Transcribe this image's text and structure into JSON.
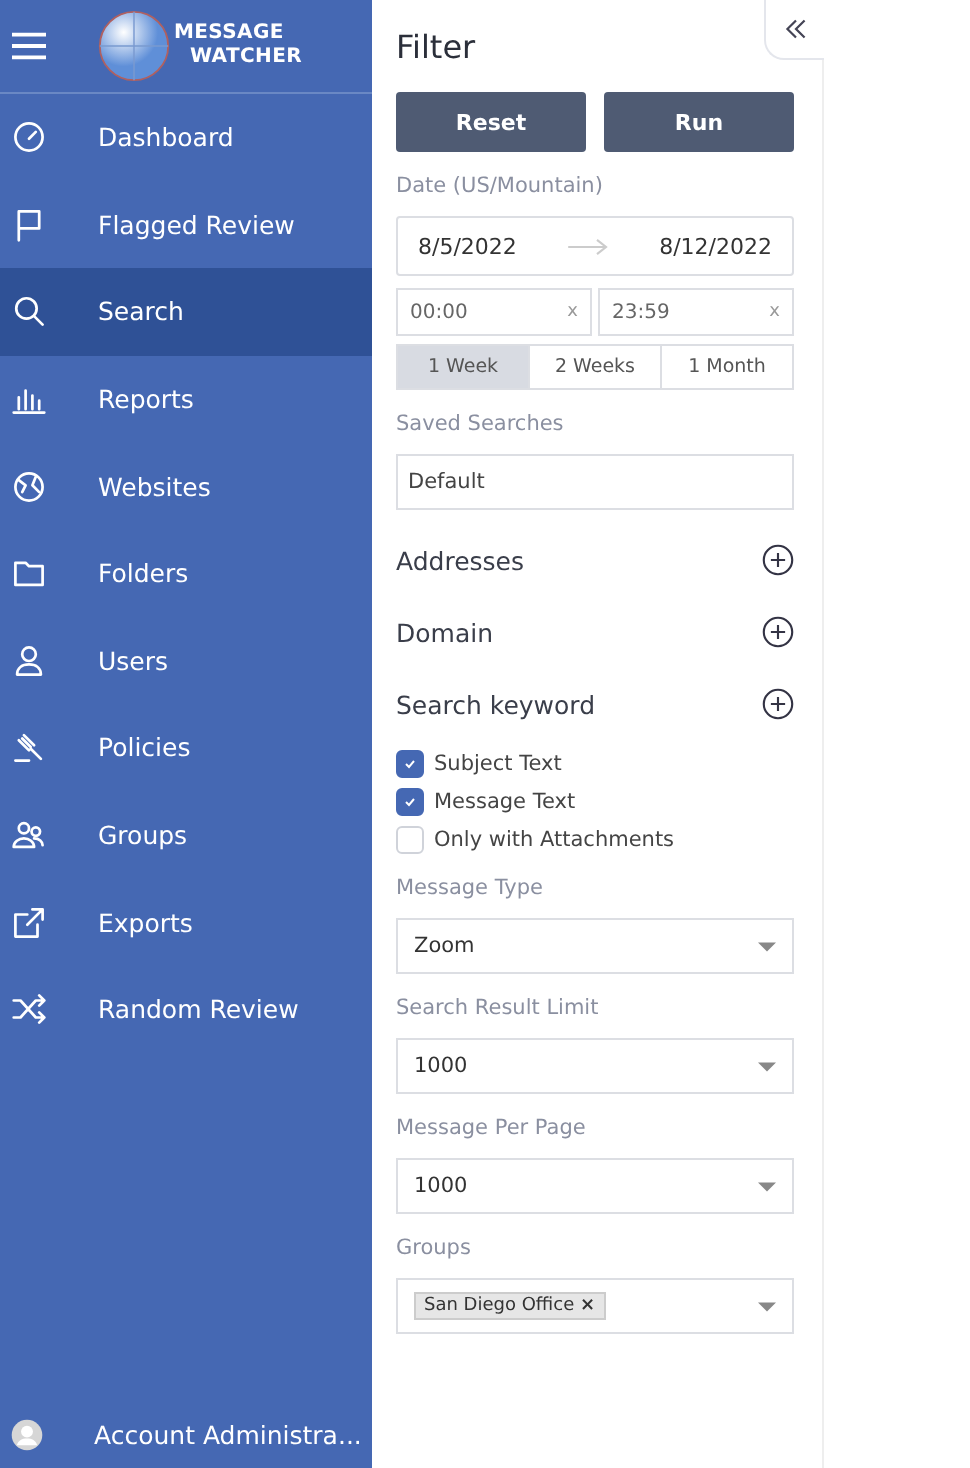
{
  "sidebar": {
    "logo_lines": [
      "MESSAGE",
      "WATCHER"
    ],
    "items": [
      {
        "label": "Dashboard",
        "selected": false
      },
      {
        "label": "Flagged Review",
        "selected": false
      },
      {
        "label": "Search",
        "selected": true
      },
      {
        "label": "Reports",
        "selected": false
      },
      {
        "label": "Websites",
        "selected": false
      },
      {
        "label": "Folders",
        "selected": false
      },
      {
        "label": "Users",
        "selected": false
      },
      {
        "label": "Policies",
        "selected": false
      },
      {
        "label": "Groups",
        "selected": false
      },
      {
        "label": "Exports",
        "selected": false
      },
      {
        "label": "Random Review",
        "selected": false
      }
    ],
    "account": "Account Administra..."
  },
  "filter": {
    "title": "Filter",
    "buttons": [
      "Reset",
      "Run"
    ],
    "date_label": "Date (US/Mountain)",
    "date_from": "8/5/2022",
    "date_to": "8/12/2022",
    "time_from": "00:00",
    "time_to": "23:59",
    "clear_marks": [
      "x",
      "x"
    ],
    "ranges": [
      {
        "label": "1 Week",
        "selected": true
      },
      {
        "label": "2 Weeks",
        "selected": false
      },
      {
        "label": "1 Month",
        "selected": false
      }
    ],
    "saved_label": "Saved Searches",
    "saved_value": "Default",
    "sections": [
      "Addresses",
      "Domain",
      "Search keyword"
    ],
    "checkboxes": [
      {
        "label": "Subject Text",
        "checked": true
      },
      {
        "label": "Message Text",
        "checked": true
      },
      {
        "label": "Only with Attachments",
        "checked": false
      }
    ],
    "selects": [
      {
        "label": "Message Type",
        "value": "Zoom"
      },
      {
        "label": "Search Result Limit",
        "value": "1000"
      },
      {
        "label": "Message Per Page",
        "value": "1000"
      }
    ],
    "groups_label": "Groups",
    "groups_tag": "San Diego Office",
    "tag_remove": "×"
  }
}
